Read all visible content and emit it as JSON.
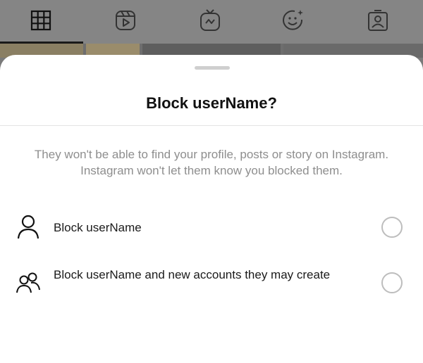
{
  "tabs": [
    {
      "name": "grid",
      "icon": "grid-icon",
      "active": true
    },
    {
      "name": "reels",
      "icon": "reels-icon",
      "active": false
    },
    {
      "name": "igtv",
      "icon": "igtv-icon",
      "active": false
    },
    {
      "name": "guides",
      "icon": "guides-icon",
      "active": false
    },
    {
      "name": "tagged",
      "icon": "tagged-icon",
      "active": false
    }
  ],
  "sheet": {
    "title": "Block userName?",
    "description": "They won't be able to find your profile, posts or story on Instagram. Instagram won't let them know you blocked them.",
    "options": [
      {
        "icon": "person-icon",
        "label": "Block userName",
        "selected": false
      },
      {
        "icon": "people-icon",
        "label": "Block userName and new accounts they may create",
        "selected": false
      }
    ]
  },
  "colors": {
    "overlay": "#7a7a7a",
    "sheet_background": "#ffffff",
    "title": "#111111",
    "description": "#8e8e8e",
    "radio_border": "#bdbdbd"
  }
}
